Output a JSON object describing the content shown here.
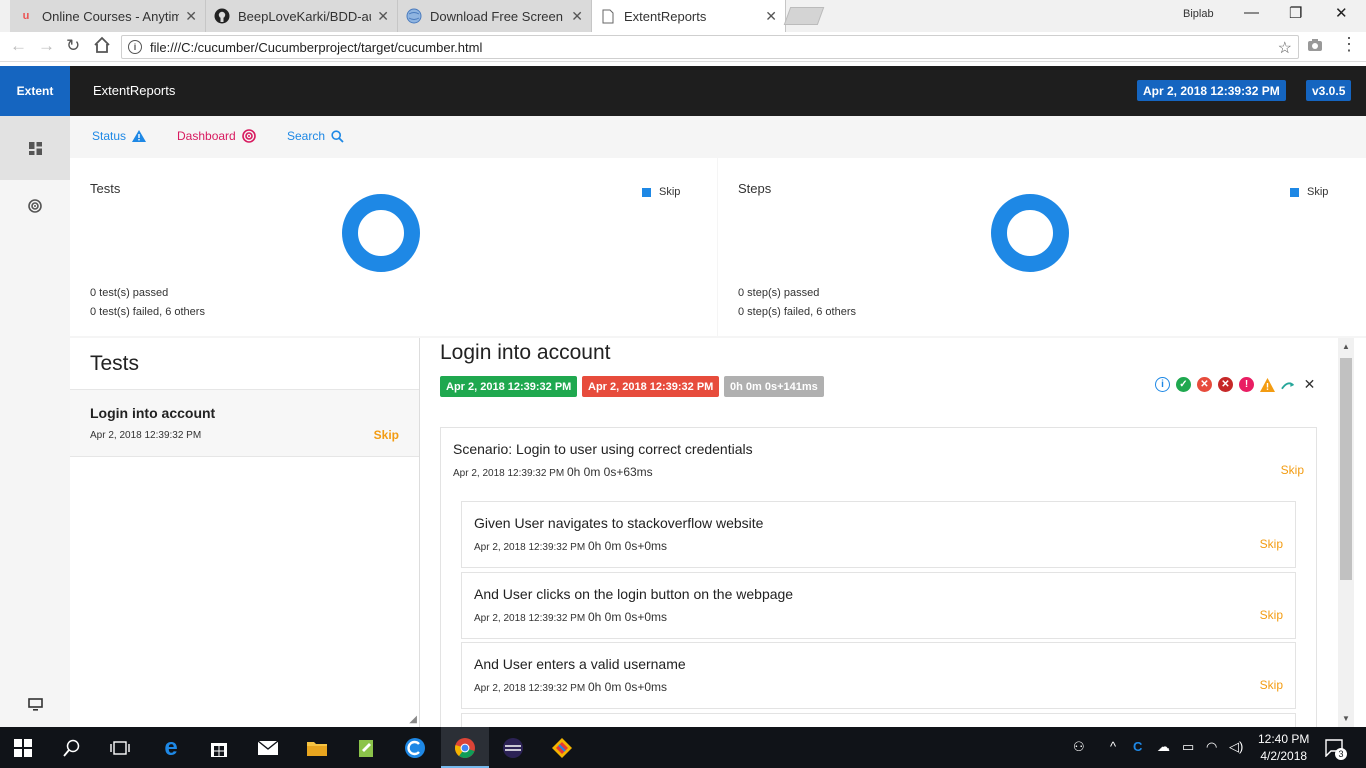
{
  "browser": {
    "tabs": [
      {
        "title": "Online Courses - Anytime",
        "favicon": "udemy-icon"
      },
      {
        "title": "BeepLoveKarki/BDD-auto",
        "favicon": "github-icon"
      },
      {
        "title": "Download Free Screen Re",
        "favicon": "globe-icon"
      },
      {
        "title": "ExtentReports",
        "favicon": "page-icon"
      }
    ],
    "profile_name": "Biplab",
    "url": "file:///C:/cucumber/Cucumberproject/target/cucumber.html"
  },
  "report": {
    "brand": "Extent",
    "name": "ExtentReports",
    "timestamp_badge": "Apr 2, 2018 12:39:32 PM",
    "version_badge": "v3.0.5"
  },
  "subnav": {
    "status": "Status",
    "dashboard": "Dashboard",
    "search": "Search"
  },
  "dashboard": {
    "tests": {
      "title": "Tests",
      "legend": "Skip",
      "passed_line": "0 test(s) passed",
      "failed_line": "0 test(s) failed, 6 others",
      "chart_data": {
        "type": "pie",
        "categories": [
          "Skip"
        ],
        "values": [
          100
        ]
      }
    },
    "steps": {
      "title": "Steps",
      "legend": "Skip",
      "passed_line": "0 step(s) passed",
      "failed_line": "0 step(s) failed, 6 others",
      "chart_data": {
        "type": "pie",
        "categories": [
          "Skip"
        ],
        "values": [
          100
        ]
      }
    }
  },
  "test_list": {
    "heading": "Tests",
    "items": [
      {
        "name": "Login into account",
        "time": "Apr 2, 2018 12:39:32 PM",
        "status": "Skip"
      }
    ]
  },
  "detail": {
    "title": "Login into account",
    "start_time": "Apr 2, 2018 12:39:32 PM",
    "end_time": "Apr 2, 2018 12:39:32 PM",
    "duration": "0h 0m 0s+141ms",
    "scenario": {
      "title": "Scenario: Login to user using correct credentials",
      "time": "Apr 2, 2018 12:39:32 PM",
      "duration": "0h 0m 0s+63ms",
      "status": "Skip",
      "steps": [
        {
          "title": "Given User navigates to stackoverflow website",
          "time": "Apr 2, 2018 12:39:32 PM",
          "duration": "0h 0m 0s+0ms",
          "status": "Skip"
        },
        {
          "title": "And User clicks on the login button on the webpage",
          "time": "Apr 2, 2018 12:39:32 PM",
          "duration": "0h 0m 0s+0ms",
          "status": "Skip"
        },
        {
          "title": "And User enters a valid username",
          "time": "Apr 2, 2018 12:39:32 PM",
          "duration": "0h 0m 0s+0ms",
          "status": "Skip"
        }
      ]
    }
  },
  "taskbar": {
    "time": "12:40 PM",
    "date": "4/2/2018",
    "notification_count": "3"
  },
  "colors": {
    "brand_blue": "#1565c0",
    "skip_blue": "#1e88e5",
    "skip_orange": "#f39c12",
    "pass_green": "#1fa84f",
    "fail_red": "#e74c3c",
    "duration_gray": "#b0b0b0"
  }
}
